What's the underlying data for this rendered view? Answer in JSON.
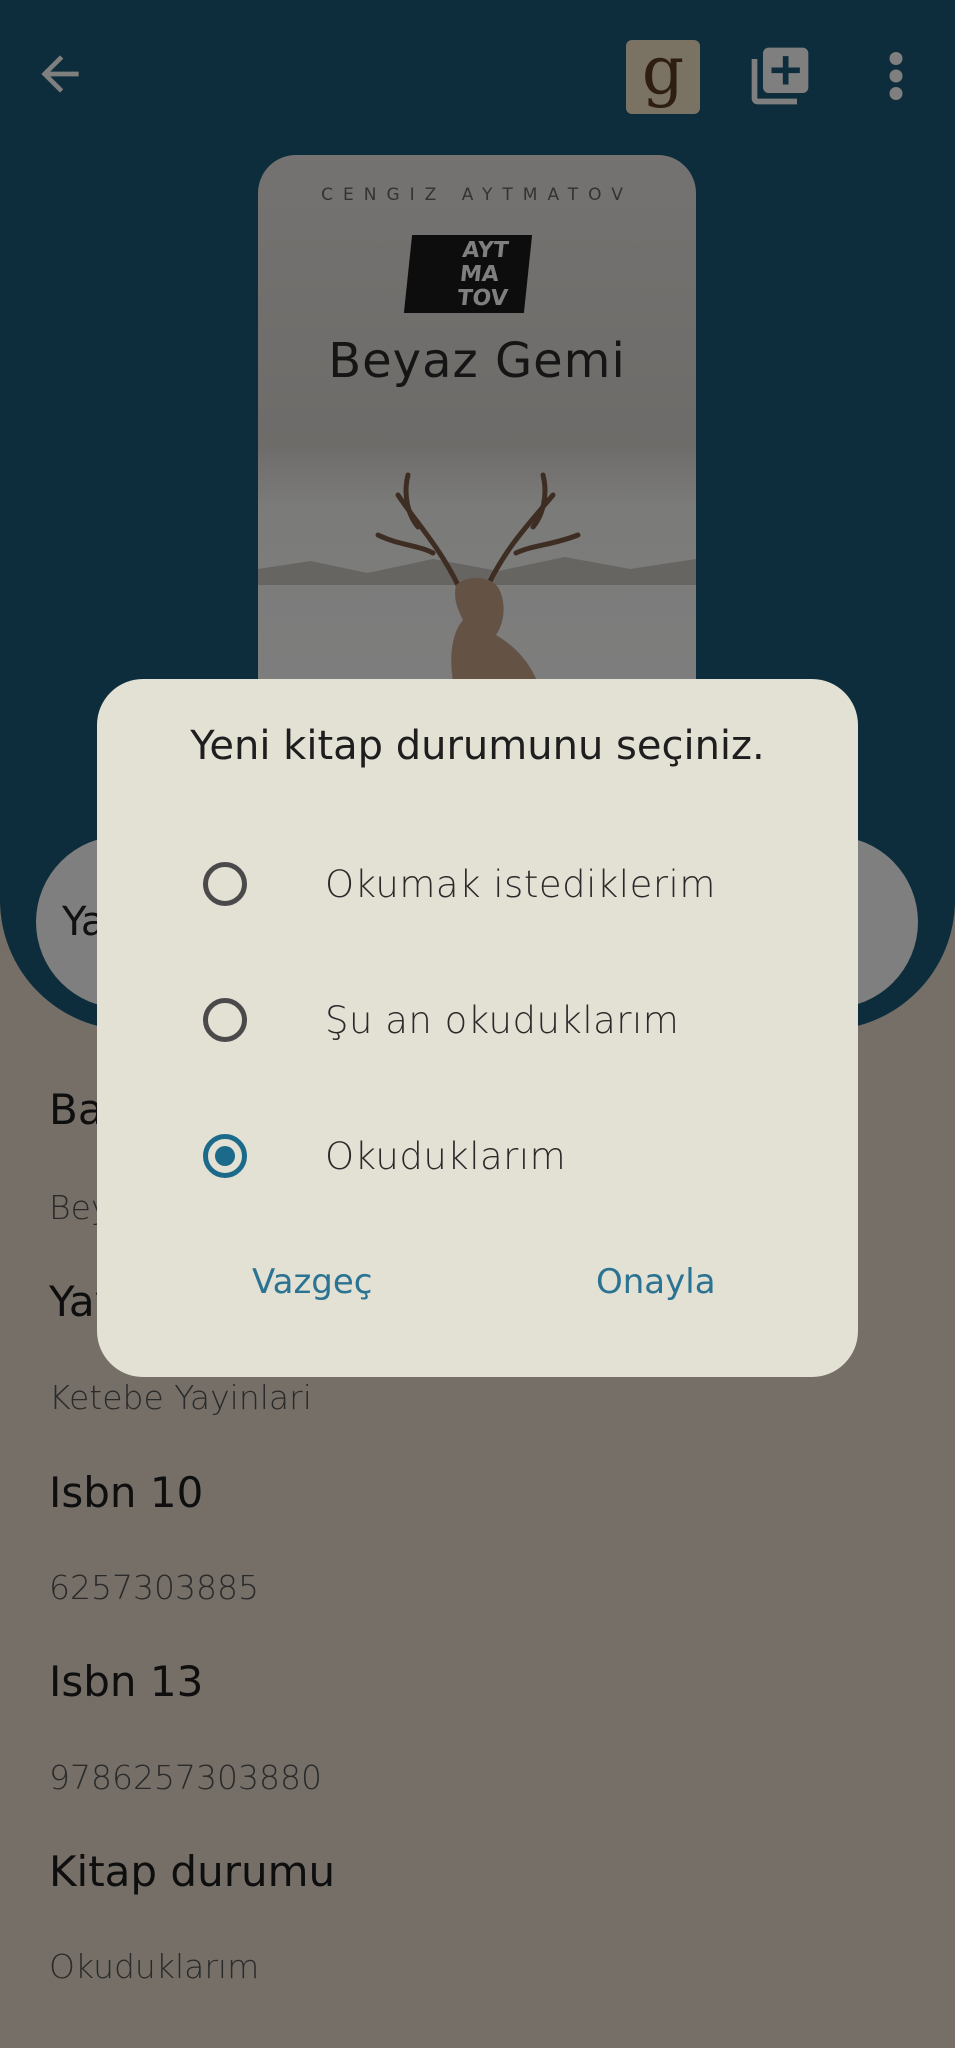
{
  "header": {
    "goodreads_letter": "g"
  },
  "cover": {
    "author": "CENGIZ AYTMATOV",
    "logo": [
      "AYT",
      "MA",
      "TOV"
    ],
    "title": "Beyaz Gemi"
  },
  "status_pill": {
    "label_partial": "Ya"
  },
  "details": [
    {
      "label": "Ba",
      "value": "Bey"
    },
    {
      "label": "Yay",
      "value": "Ketebe Yayinlari"
    },
    {
      "label": "Isbn 10",
      "value": "6257303885"
    },
    {
      "label": "Isbn 13",
      "value": "9786257303880"
    },
    {
      "label": "Kitap durumu",
      "value": "Okuduklarım"
    }
  ],
  "dialog": {
    "title": "Yeni kitap durumunu seçiniz.",
    "options": [
      {
        "label": "Okumak istediklerim",
        "checked": false
      },
      {
        "label": "Şu an okuduklarım",
        "checked": false
      },
      {
        "label": "Okuduklarım",
        "checked": true
      }
    ],
    "cancel_label": "Vazgeç",
    "confirm_label": "Onayla"
  },
  "colors": {
    "header_bg": "#1a5b78",
    "accent": "#1c6a8a",
    "page_bg": "#eadfd0",
    "dialog_bg": "#e3e0d4"
  }
}
